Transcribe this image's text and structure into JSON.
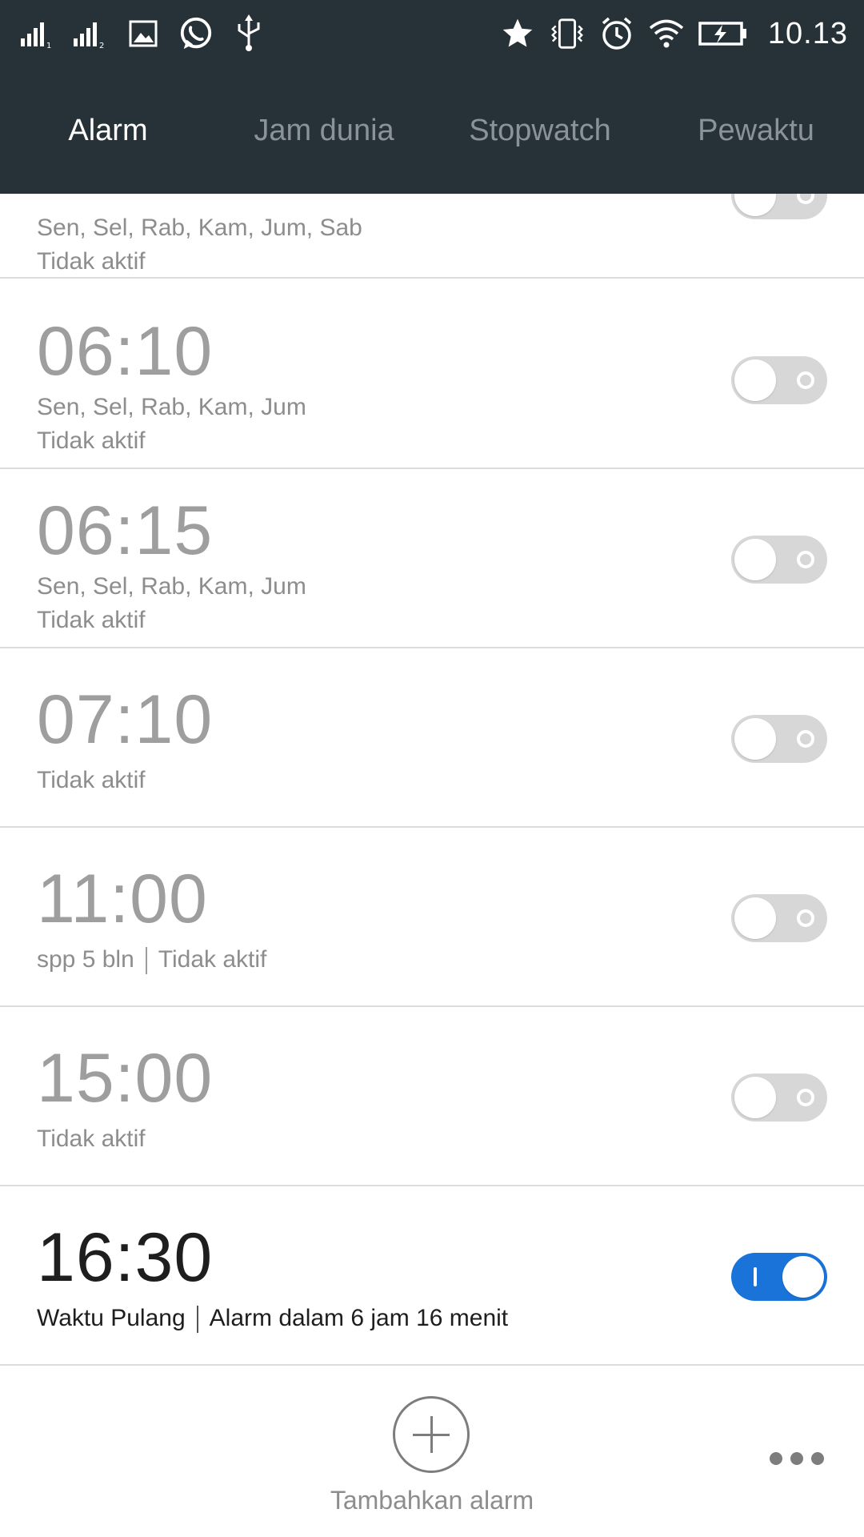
{
  "status_bar": {
    "left_icons": [
      "signal-sim1-icon",
      "signal-sim2-icon",
      "gallery-icon",
      "whatsapp-icon",
      "usb-icon"
    ],
    "right_icons": [
      "star-icon",
      "vibrate-icon",
      "alarm-icon",
      "wifi-icon",
      "battery-charging-icon"
    ],
    "time": "10.13"
  },
  "tabs": [
    {
      "label": "Alarm",
      "active": true
    },
    {
      "label": "Jam dunia",
      "active": false
    },
    {
      "label": "Stopwatch",
      "active": false
    },
    {
      "label": "Pewaktu",
      "active": false
    }
  ],
  "alarms": [
    {
      "time": "",
      "days": "Sen, Sel, Rab, Kam, Jum, Sab",
      "status": "Tidak aktif",
      "enabled": false
    },
    {
      "time": "06:10",
      "days": "Sen, Sel, Rab, Kam, Jum",
      "status": "Tidak aktif",
      "enabled": false
    },
    {
      "time": "06:15",
      "days": "Sen, Sel, Rab, Kam, Jum",
      "status": "Tidak aktif",
      "enabled": false
    },
    {
      "time": "07:10",
      "days": "",
      "status": "Tidak aktif",
      "enabled": false
    },
    {
      "time": "11:00",
      "label": "spp 5 bln",
      "status": "Tidak aktif",
      "enabled": false
    },
    {
      "time": "15:00",
      "days": "",
      "status": "Tidak aktif",
      "enabled": false
    },
    {
      "time": "16:30",
      "label": "Waktu Pulang",
      "status": "Alarm dalam 6 jam 16 menit",
      "enabled": true
    }
  ],
  "bottom": {
    "add_label": "Tambahkan alarm",
    "add_icon": "plus-circle-icon",
    "more_icon": "more-dots-icon"
  },
  "colors": {
    "header": "#263238",
    "toggle_on": "#1a73d9",
    "toggle_off": "#d7d7d7"
  }
}
